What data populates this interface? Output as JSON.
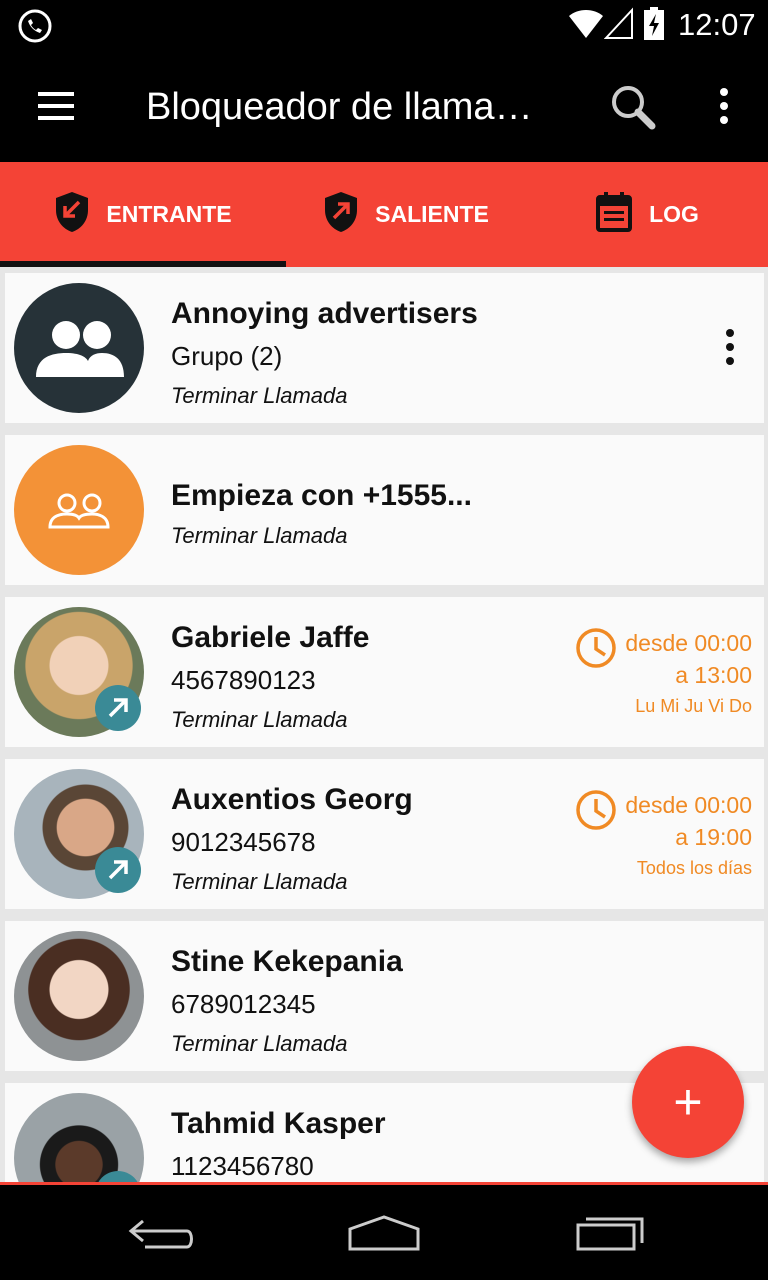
{
  "status_bar": {
    "time": "12:07"
  },
  "app_bar": {
    "title": "Bloqueador de llama…"
  },
  "tabs": [
    {
      "label": "ENTRANTE",
      "icon": "shield-incoming-icon",
      "selected": true
    },
    {
      "label": "SALIENTE",
      "icon": "shield-outgoing-icon",
      "selected": false
    },
    {
      "label": "LOG",
      "icon": "calendar-icon",
      "selected": false
    }
  ],
  "list": [
    {
      "name": "Annoying advertisers",
      "subtitle": "Grupo (2)",
      "action": "Terminar Llamada",
      "avatar": "group-icon",
      "avatar_color": "#263238"
    },
    {
      "name": "Empieza con +1555...",
      "action": "Terminar Llamada",
      "avatar": "group-outline-icon",
      "avatar_color": "#f39237"
    },
    {
      "name": "Gabriele Jaffe",
      "subtitle": "4567890123",
      "action": "Terminar Llamada",
      "schedule": {
        "from": "desde 00:00",
        "to": "a 13:00",
        "days": "Lu Mi Ju Vi Do"
      }
    },
    {
      "name": "Auxentios Georg",
      "subtitle": "9012345678",
      "action": "Terminar Llamada",
      "schedule": {
        "from": "desde 00:00",
        "to": "a 19:00",
        "days": "Todos los días"
      }
    },
    {
      "name": "Stine Kekepania",
      "subtitle": "6789012345",
      "action": "Terminar Llamada"
    },
    {
      "name": "Tahmid Kasper",
      "subtitle": "1123456780"
    }
  ],
  "fab": {
    "label": "+"
  },
  "colors": {
    "accent": "#f44336",
    "schedule": "#f08a24",
    "badge": "#3a8a96"
  }
}
